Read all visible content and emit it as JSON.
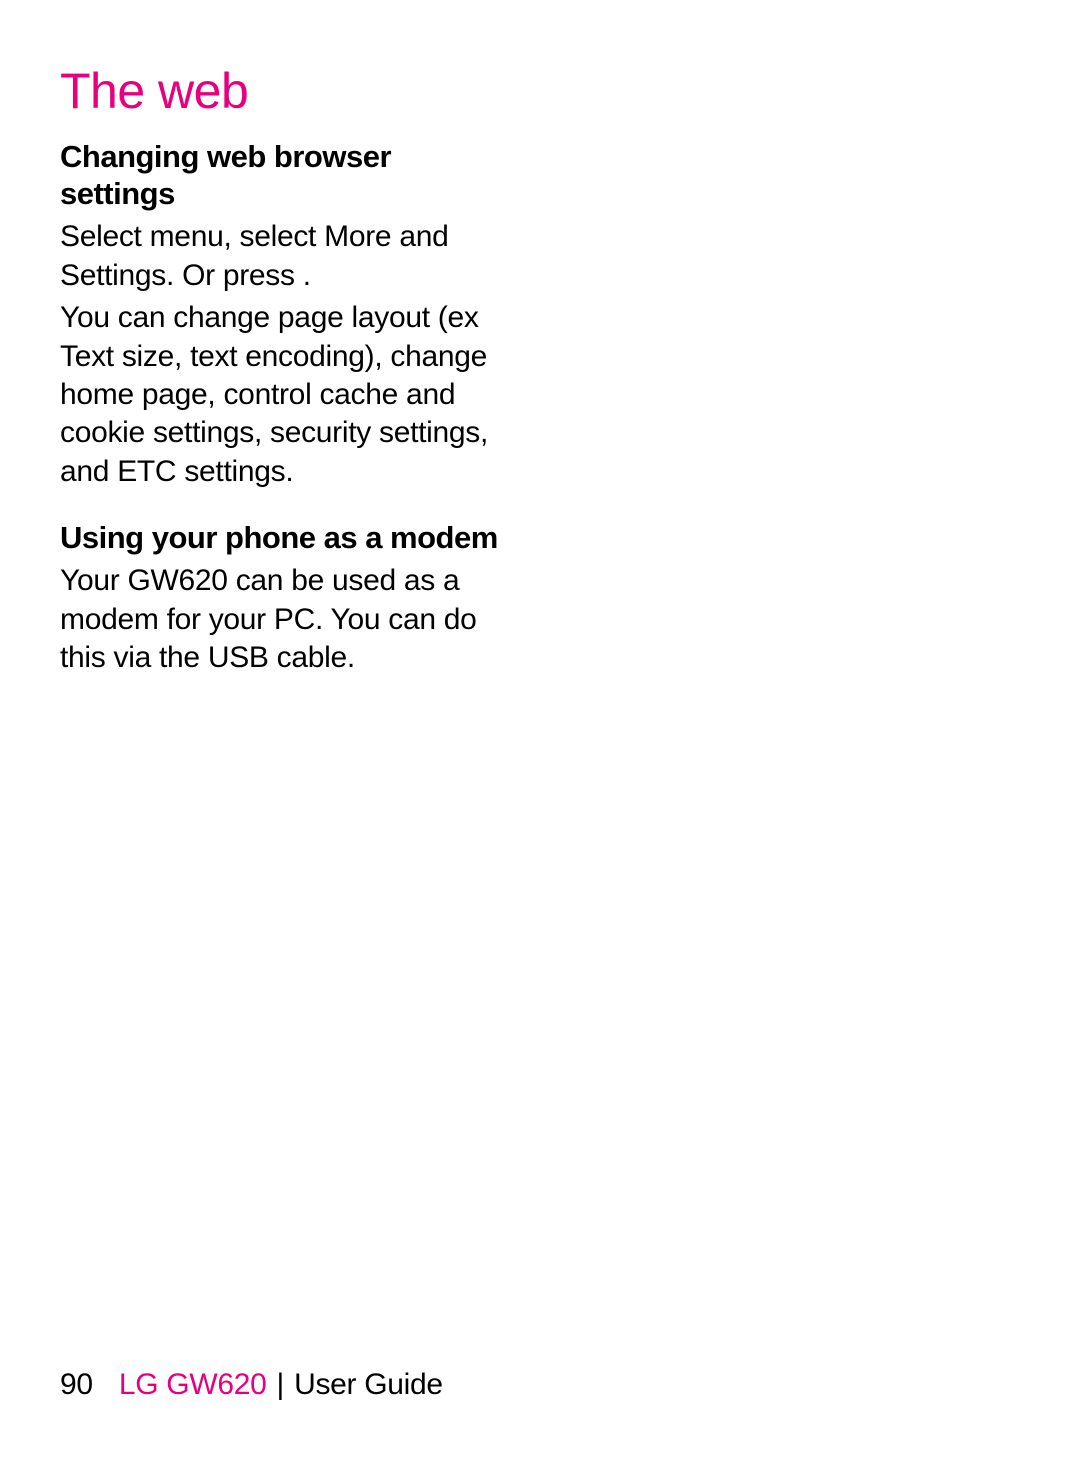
{
  "colors": {
    "accent": "#e6007e",
    "text": "#000000",
    "background": "#ffffff"
  },
  "page": {
    "title": "The web",
    "sections": [
      {
        "heading": "Changing web browser settings",
        "paragraphs": [
          "Select menu, select More and Settings. Or press       .",
          "You can change page layout (ex Text size, text encoding), change home page, control cache and cookie settings, security settings, and ETC settings."
        ]
      },
      {
        "heading": "Using your phone as a modem",
        "paragraphs": [
          "Your GW620 can be used as a modem for your PC. You can do this via the USB cable."
        ]
      }
    ]
  },
  "footer": {
    "page_number": "90",
    "brand": "LG GW620",
    "separator": "  |  ",
    "guide": "User Guide"
  }
}
